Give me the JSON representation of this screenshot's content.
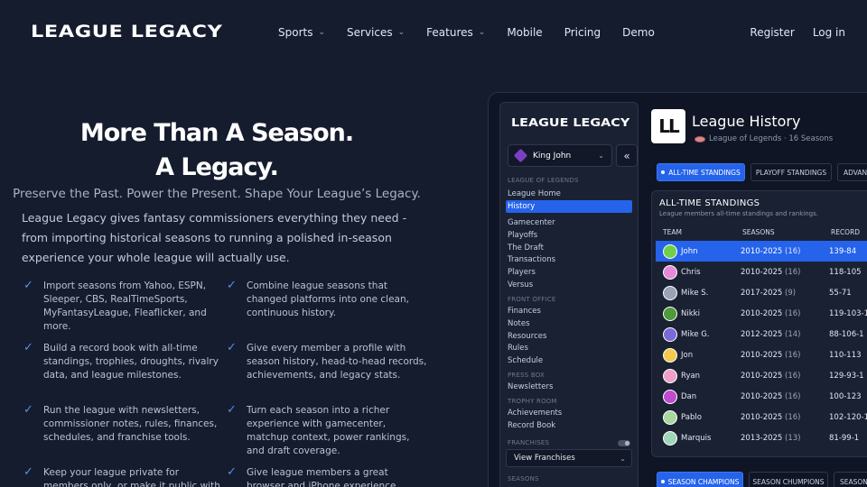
{
  "brand": {
    "name": "LEAGUE LEGACY"
  },
  "nav": {
    "items": [
      {
        "label": "Sports",
        "dropdown": true
      },
      {
        "label": "Services",
        "dropdown": true
      },
      {
        "label": "Features",
        "dropdown": true
      },
      {
        "label": "Mobile",
        "dropdown": false
      },
      {
        "label": "Pricing",
        "dropdown": false
      },
      {
        "label": "Demo",
        "dropdown": false
      }
    ],
    "register": "Register",
    "login": "Log in"
  },
  "hero": {
    "title_line1": "More Than A Season.",
    "title_line2": "A Legacy.",
    "tagline": "Preserve the Past. Power the Present. Shape Your League’s Legacy.",
    "intro": "League Legacy gives fantasy commissioners everything they need - from importing historical seasons to running a polished in-season experience your whole league will actually use."
  },
  "features": [
    "Import seasons from Yahoo, ESPN, Sleeper, CBS, RealTimeSports, MyFantasyLeague, Fleaflicker, and more.",
    "Combine league seasons that changed platforms into one clean, continuous history.",
    "Build a record book with all-time standings, trophies, droughts, rivalry data, and league milestones.",
    "Give every member a profile with season history, head-to-head records, achievements, and legacy stats.",
    "Run the league with newsletters, commissioner notes, rules, finances, schedules, and franchise tools.",
    "Turn each season into a richer experience with gamecenter, matchup context, power rankings, and draft coverage.",
    "Keep your league private for members only, or make it public with",
    "Give league members a great browser and iPhone experience"
  ],
  "app": {
    "logo": "LEAGUE LEGACY",
    "user": "King John",
    "collapse_icon": "«",
    "sections": {
      "league": "LEAGUE OF LEGENDS",
      "front_office": "FRONT OFFICE",
      "press_box": "PRESS BOX",
      "trophy_room": "TROPHY ROOM",
      "franchises": "FRANCHISES",
      "seasons": "SEASONS"
    },
    "league_items": [
      "League Home",
      "History",
      "Gamecenter",
      "Playoffs",
      "The Draft",
      "Transactions",
      "Players",
      "Versus"
    ],
    "front_office_items": [
      "Finances",
      "Notes",
      "Resources",
      "Rules",
      "Schedule"
    ],
    "press_box_items": [
      "Newsletters"
    ],
    "trophy_room_items": [
      "Achievements",
      "Record Book"
    ],
    "franchise_select": "View Franchises",
    "page": {
      "icon_text": "LL",
      "title": "League History",
      "subtitle": "League of Legends · 16 Seasons"
    },
    "tabs": [
      "ALL-TIME STANDINGS",
      "PLAYOFF STANDINGS",
      "ADVAN"
    ],
    "standings": {
      "title": "ALL-TIME STANDINGS",
      "subtitle": "League members all-time standings and rankings.",
      "headers": {
        "team": "TEAM",
        "seasons": "SEASONS",
        "record": "RECORD"
      },
      "rows": [
        {
          "team": "John",
          "seasons": "2010-2025",
          "count": "(16)",
          "record": "139-84",
          "color": "#6fcf4a"
        },
        {
          "team": "Chris",
          "seasons": "2010-2025",
          "count": "(16)",
          "record": "118-105",
          "color": "#e58ad8"
        },
        {
          "team": "Mike S.",
          "seasons": "2017-2025",
          "count": "(9)",
          "record": "55-71",
          "color": "#9aa3b5"
        },
        {
          "team": "Nikki",
          "seasons": "2010-2025",
          "count": "(16)",
          "record": "119-103-1",
          "color": "#4f9a3a"
        },
        {
          "team": "Mike G.",
          "seasons": "2012-2025",
          "count": "(14)",
          "record": "88-106-1",
          "color": "#7a6ad8"
        },
        {
          "team": "Jon",
          "seasons": "2010-2025",
          "count": "(16)",
          "record": "110-113",
          "color": "#f2c94c"
        },
        {
          "team": "Ryan",
          "seasons": "2010-2025",
          "count": "(16)",
          "record": "129-93-1",
          "color": "#f0a0c8"
        },
        {
          "team": "Dan",
          "seasons": "2010-2025",
          "count": "(16)",
          "record": "100-123",
          "color": "#c04ad0"
        },
        {
          "team": "Pablo",
          "seasons": "2010-2025",
          "count": "(16)",
          "record": "102-120-1",
          "color": "#a8d8a0"
        },
        {
          "team": "Marquis",
          "seasons": "2013-2025",
          "count": "(13)",
          "record": "81-99-1",
          "color": "#9fd6b8"
        }
      ]
    },
    "bottom_tabs": [
      "SEASON CHAMPIONS",
      "SEASON CHUMPIONS",
      "SEASON"
    ]
  }
}
